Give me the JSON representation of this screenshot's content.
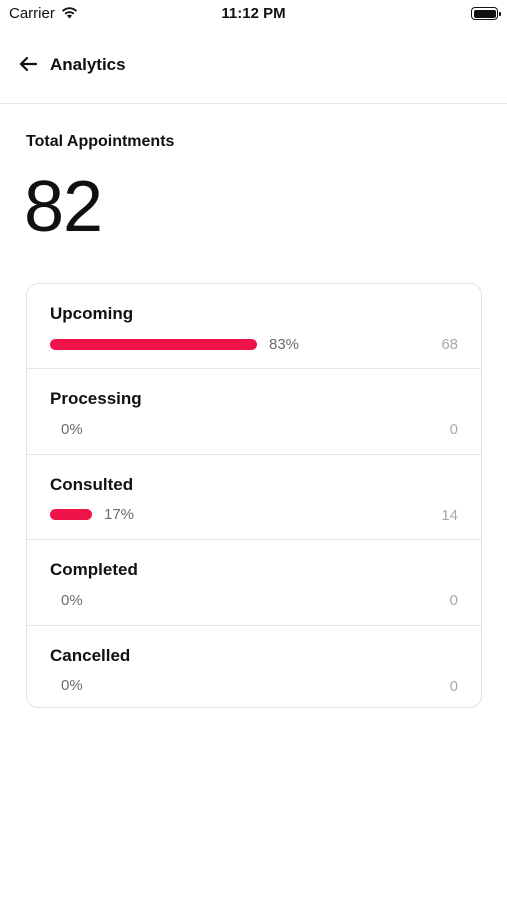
{
  "status_bar": {
    "carrier": "Carrier",
    "time": "11:12 PM"
  },
  "app_bar": {
    "title": "Analytics",
    "back_icon": "arrow-left-icon"
  },
  "summary": {
    "label": "Total Appointments",
    "value": "82"
  },
  "accent_color": "#f0134a",
  "stats": [
    {
      "label": "Upcoming",
      "percent_text": "83%",
      "count": "68",
      "fraction": 0.83
    },
    {
      "label": "Processing",
      "percent_text": "0%",
      "count": "0",
      "fraction": 0
    },
    {
      "label": "Consulted",
      "percent_text": "17%",
      "count": "14",
      "fraction": 0.17
    },
    {
      "label": "Completed",
      "percent_text": "0%",
      "count": "0",
      "fraction": 0
    },
    {
      "label": "Cancelled",
      "percent_text": "0%",
      "count": "0",
      "fraction": 0
    }
  ]
}
